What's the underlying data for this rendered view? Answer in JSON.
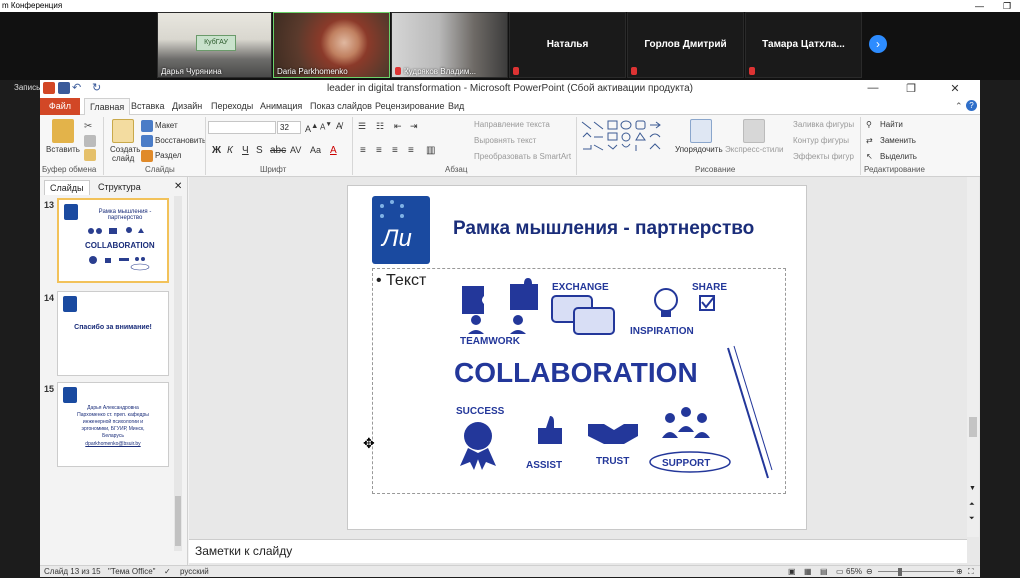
{
  "zoom": {
    "title": "m Конференция",
    "recording": "Запись...",
    "participants": [
      {
        "name": "Дарья Чурянина"
      },
      {
        "name": "Daria Parkhomenko"
      },
      {
        "name": "Кудряков Владим..."
      }
    ],
    "named_tiles": [
      "Наталья",
      "Горлов Дмитрий",
      "Тамара  Цатхла..."
    ],
    "logo_text": "КубГАУ"
  },
  "ppt": {
    "window_title": "leader in digital transformation  -  Microsoft PowerPoint (Сбой активации продукта)",
    "tabs": [
      "Файл",
      "Главная",
      "Вставка",
      "Дизайн",
      "Переходы",
      "Анимация",
      "Показ слайдов",
      "Рецензирование",
      "Вид"
    ],
    "ribbon": {
      "clipboard": {
        "paste": "Вставить",
        "label": "Буфер обмена"
      },
      "slides": {
        "new": "Создать",
        "new2": "слайд",
        "layout": "Макет",
        "reset": "Восстановить",
        "section": "Раздел",
        "label": "Слайды"
      },
      "font": {
        "size": "32",
        "label": "Шрифт"
      },
      "paragraph": {
        "text_direction": "Направление текста",
        "align": "Выровнять текст",
        "smartart": "Преобразовать в SmartArt",
        "label": "Абзац"
      },
      "drawing": {
        "arrange": "Упорядочить",
        "quick_styles": "Экспресс-стили",
        "fill": "Заливка фигуры",
        "outline": "Контур фигуры",
        "effects": "Эффекты фигур",
        "label": "Рисование"
      },
      "editing": {
        "find": "Найти",
        "replace": "Заменить",
        "select": "Выделить",
        "label": "Редактирование"
      }
    },
    "panel_tabs": [
      "Слайды",
      "Структура"
    ],
    "thumbnails": [
      {
        "num": "13",
        "text": "Рамка мышления - партнерство",
        "word": "COLLABORATION"
      },
      {
        "num": "14",
        "text": "Спасибо за внимание!"
      },
      {
        "num": "15",
        "text": "Дарья Александровна Пархоменко ст. преп. кафедры инженерной психологии и эргономики, БГУИР, Минск, Беларусь",
        "email": "dparkhomenko@bsuir.by"
      }
    ],
    "slide": {
      "logo_text": "Ли",
      "title": "Рамка мышления - партнерство",
      "bullet": "Текст",
      "graphic": {
        "center": "COLLABORATION",
        "labels": [
          "TEAMWORK",
          "EXCHANGE",
          "INSPIRATION",
          "SHARE",
          "SUCCESS",
          "ASSIST",
          "TRUST",
          "SUPPORT"
        ]
      }
    },
    "notes_placeholder": "Заметки к слайду",
    "status": {
      "slide": "Слайд 13 из 15",
      "theme": "\"Тема Office\"",
      "lang": "русский",
      "zoom": "65%"
    }
  }
}
